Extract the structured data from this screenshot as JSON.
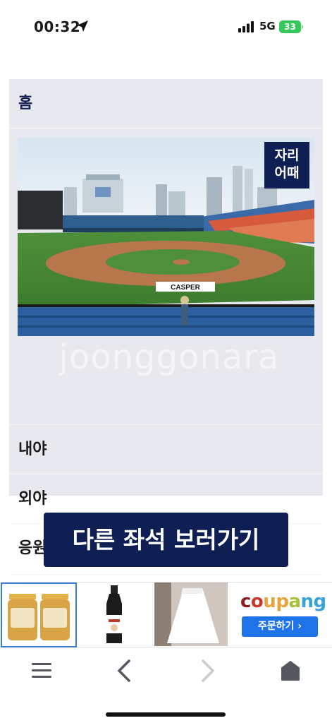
{
  "status_bar": {
    "time": "00:32",
    "network": "5G",
    "battery": "33",
    "icons": [
      "location-arrow-icon",
      "signal-bars-icon",
      "battery-icon"
    ]
  },
  "menu": {
    "home": "홈",
    "badge_line1": "자리",
    "badge_line2": "어때",
    "infield": "내야",
    "outfield": "외야",
    "cheer": "응원단상"
  },
  "image": {
    "sign_text": "CASPER"
  },
  "watermark": "joonggonara",
  "cta": {
    "label": "다른 좌석 보러가기"
  },
  "ads": {
    "coupang_logo": "coupang",
    "coupang_button": "주문하기 ›",
    "coupang_colors": [
      "#8a1c1c",
      "#c9372c",
      "#e8a33b",
      "#a6c13a",
      "#3aa3d6"
    ]
  },
  "bottom_nav": {
    "icons": [
      "menu-icon",
      "back-icon",
      "forward-icon",
      "home-icon"
    ]
  },
  "colors": {
    "navy": "#0f1f54",
    "panel": "#e8e9ee",
    "battery_green": "#34c759",
    "coupang_blue": "#1f73e8"
  }
}
